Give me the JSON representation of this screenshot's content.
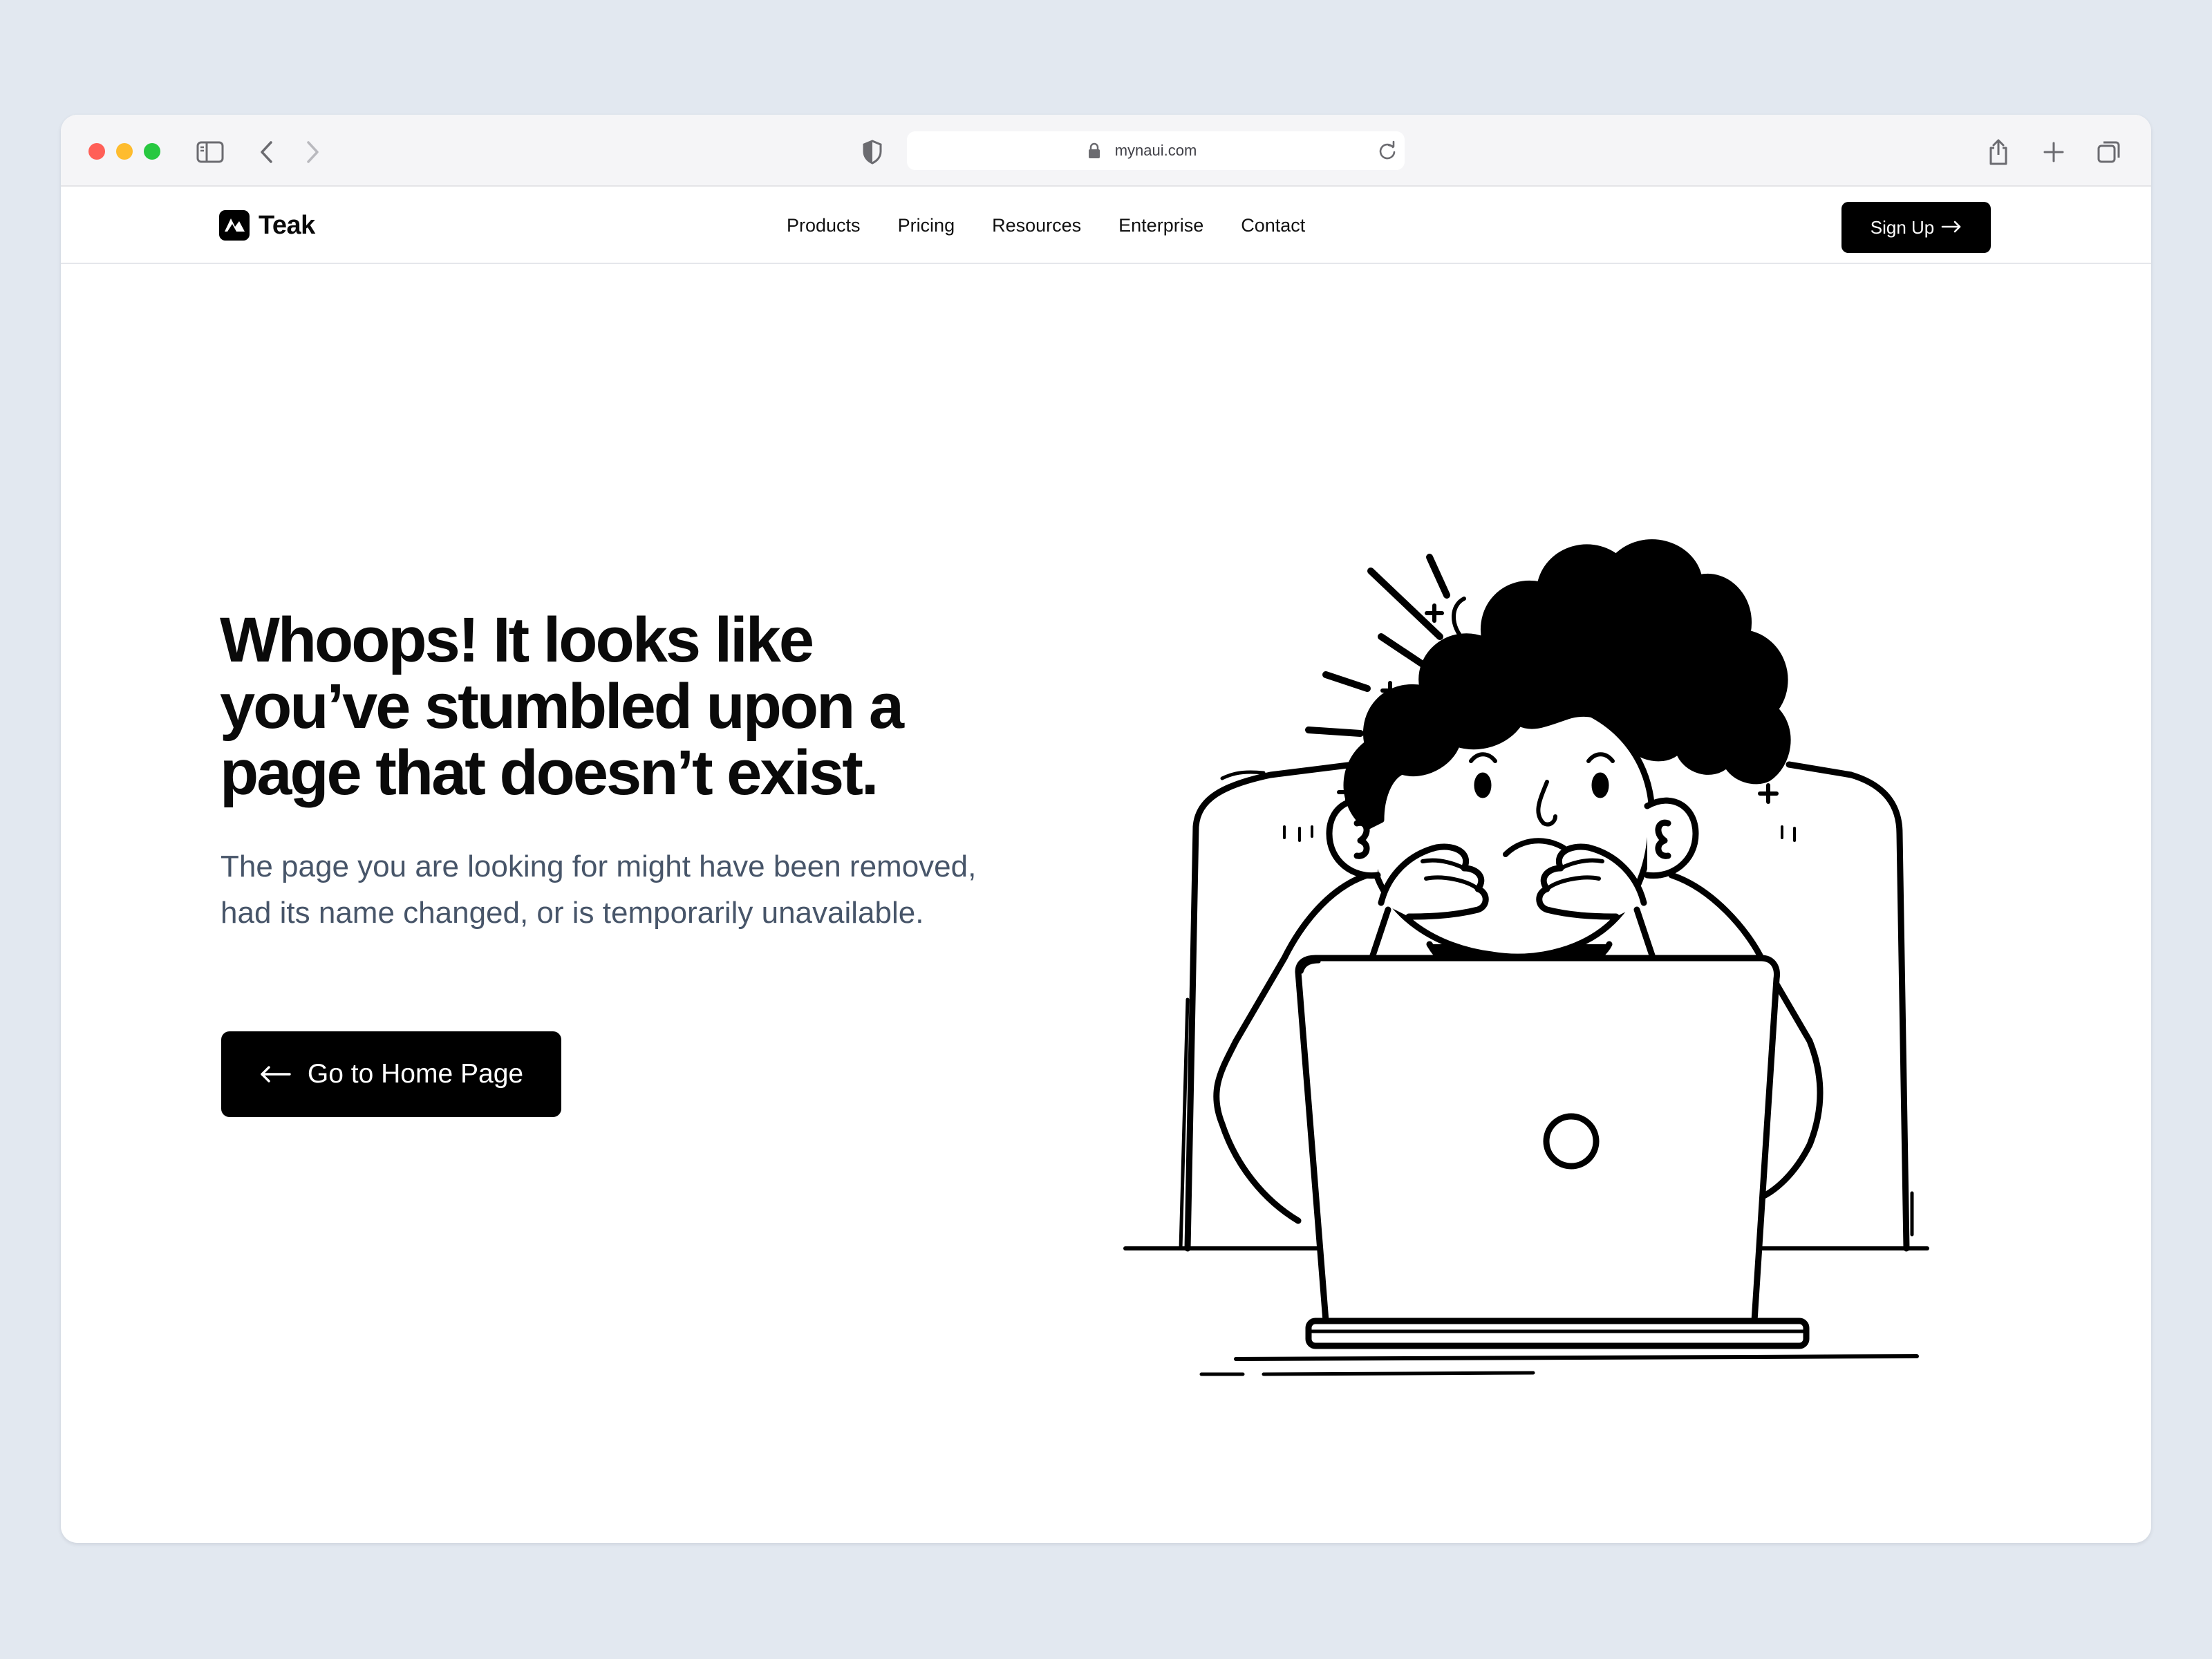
{
  "browser": {
    "url": "mynaui.com",
    "icons": [
      "sidebar-icon",
      "back-icon",
      "forward-icon",
      "shield-icon",
      "lock-icon",
      "reload-icon",
      "share-icon",
      "new-tab-icon",
      "tabs-overview-icon"
    ],
    "traffic_lights": [
      "#ff5f57",
      "#febc2e",
      "#28c840"
    ]
  },
  "header": {
    "brand": "Teak",
    "nav": [
      {
        "label": "Products"
      },
      {
        "label": "Pricing"
      },
      {
        "label": "Resources"
      },
      {
        "label": "Enterprise"
      },
      {
        "label": "Contact"
      }
    ],
    "signup_label": "Sign Up"
  },
  "hero": {
    "heading_lines": [
      "Whoops! It looks like",
      "you’ve stumbled upon a",
      "page that doesn’t exist."
    ],
    "subtext": "The page you are looking for might have been removed, had its name changed, or is temporarily unavailable.",
    "button_label": "Go to Home Page"
  },
  "illustration": {
    "subject": "stressed-person-at-laptop-illustration"
  },
  "colors": {
    "background": "#e2e8f0",
    "primary": "#000000",
    "body_text": "#475569"
  }
}
